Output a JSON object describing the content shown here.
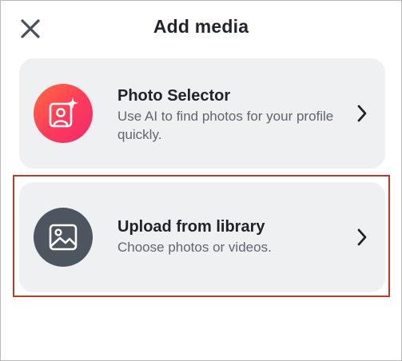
{
  "header": {
    "title": "Add media",
    "close_icon": "close-icon"
  },
  "options": [
    {
      "title": "Photo Selector",
      "subtitle": "Use AI to find photos for your profile quickly.",
      "icon": "ai-photo-selector-icon",
      "icon_colors": [
        "#ff6a3d",
        "#ef2a6f"
      ]
    },
    {
      "title": "Upload from library",
      "subtitle": "Choose photos or videos.",
      "icon": "image-library-icon",
      "icon_color": "#4d555f"
    }
  ],
  "highlight_color": "#c0392b"
}
